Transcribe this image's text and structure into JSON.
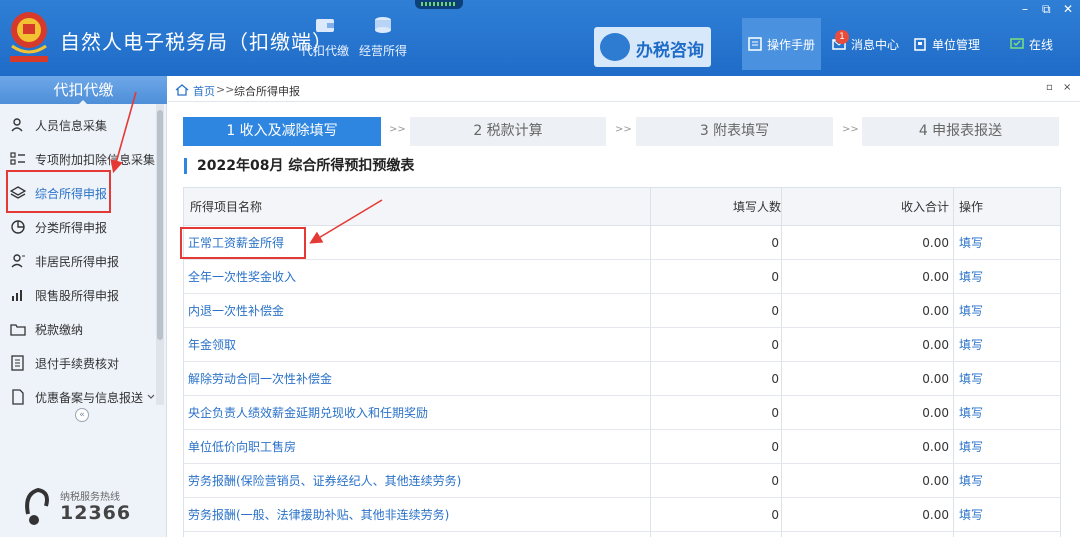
{
  "header": {
    "app_title": "自然人电子税务局（扣缴端）",
    "nav": [
      {
        "label": "代扣代缴",
        "icon": "wallet-icon"
      },
      {
        "label": "经营所得",
        "icon": "coins-icon"
      }
    ],
    "consult_label": "办税咨询",
    "tools": [
      {
        "label": "操作手册",
        "icon": "manual-icon"
      },
      {
        "label": "消息中心",
        "icon": "mail-icon",
        "badge": "1"
      },
      {
        "label": "单位管理",
        "icon": "building-icon"
      },
      {
        "label": "在线",
        "icon": "online-icon"
      }
    ],
    "window_controls": {
      "minimize": "–",
      "restore": "⧉",
      "close": "✕"
    }
  },
  "sidebar": {
    "title": "代扣代缴",
    "items": [
      {
        "label": "人员信息采集",
        "icon": "person-icon"
      },
      {
        "label": "专项附加扣除信息采集",
        "icon": "list-icon"
      },
      {
        "label": "综合所得申报",
        "icon": "layers-icon",
        "active": true
      },
      {
        "label": "分类所得申报",
        "icon": "pie-icon"
      },
      {
        "label": "非居民所得申报",
        "icon": "user-outline-icon"
      },
      {
        "label": "限售股所得申报",
        "icon": "bar-chart-icon"
      },
      {
        "label": "税款缴纳",
        "icon": "folder-icon"
      },
      {
        "label": "退付手续费核对",
        "icon": "document-icon"
      },
      {
        "label": "优惠备案与信息报送",
        "icon": "file-icon",
        "has_chevron": true
      }
    ],
    "hotline_label": "纳税服务热线",
    "hotline_number": "12366",
    "collapse_glyph": "«"
  },
  "breadcrumb": {
    "home": "首页",
    "separator": ">>",
    "current": "综合所得申报",
    "ctl_restore": "▫",
    "ctl_close": "×"
  },
  "steps": [
    {
      "label": "1 收入及减除填写",
      "active": true
    },
    {
      "label": "2 税款计算",
      "active": false
    },
    {
      "label": "3 附表填写",
      "active": false
    },
    {
      "label": "4 申报表报送",
      "active": false
    }
  ],
  "step_arrow": ">>",
  "section_title": "2022年08月  综合所得预扣预缴表",
  "table": {
    "columns": [
      "所得项目名称",
      "填写人数",
      "收入合计",
      "操作"
    ],
    "rows": [
      {
        "name": "正常工资薪金所得",
        "count": "0",
        "income": "0.00",
        "op": "填写"
      },
      {
        "name": "全年一次性奖金收入",
        "count": "0",
        "income": "0.00",
        "op": "填写"
      },
      {
        "name": "内退一次性补偿金",
        "count": "0",
        "income": "0.00",
        "op": "填写"
      },
      {
        "name": "年金领取",
        "count": "0",
        "income": "0.00",
        "op": "填写"
      },
      {
        "name": "解除劳动合同一次性补偿金",
        "count": "0",
        "income": "0.00",
        "op": "填写"
      },
      {
        "name": "央企负责人绩效薪金延期兑现收入和任期奖励",
        "count": "0",
        "income": "0.00",
        "op": "填写"
      },
      {
        "name": "单位低价向职工售房",
        "count": "0",
        "income": "0.00",
        "op": "填写"
      },
      {
        "name": "劳务报酬(保险营销员、证券经纪人、其他连续劳务)",
        "count": "0",
        "income": "0.00",
        "op": "填写"
      },
      {
        "name": "劳务报酬(一般、法律援助补贴、其他非连续劳务)",
        "count": "0",
        "income": "0.00",
        "op": "填写"
      }
    ]
  },
  "colors": {
    "brand_blue": "#1f6cc8",
    "accent_blue": "#2e86e0",
    "link_blue": "#2a72c8",
    "annotation_red": "#e53935"
  }
}
